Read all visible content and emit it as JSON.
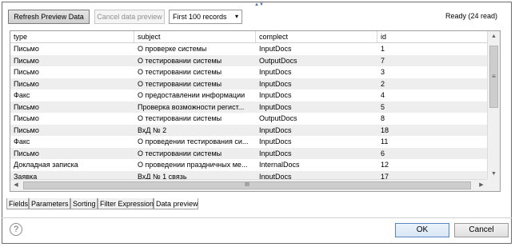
{
  "toolbar": {
    "refresh_label": "Refresh Preview Data",
    "cancel_label": "Cancel data preview",
    "records_selected": "First 100 records",
    "status": "Ready (24 read)"
  },
  "table": {
    "columns": [
      "type",
      "subject",
      "complect",
      "id"
    ],
    "rows": [
      [
        "Письмо",
        "О проверке системы",
        "InputDocs",
        "1"
      ],
      [
        "Письмо",
        "О тестировании системы",
        "OutputDocs",
        "7"
      ],
      [
        "Письмо",
        "О тестировании системы",
        "InputDocs",
        "3"
      ],
      [
        "Письмо",
        "О тестировании системы",
        "InputDocs",
        "2"
      ],
      [
        "Факс",
        "О предоставлении информации",
        "InputDocs",
        "4"
      ],
      [
        "Письмо",
        "Проверка возможности регист...",
        "InputDocs",
        "5"
      ],
      [
        "Письмо",
        "О тестировании системы",
        "OutputDocs",
        "8"
      ],
      [
        "Письмо",
        "ВхД № 2",
        "InputDocs",
        "18"
      ],
      [
        "Факс",
        "О проведении тестирования си...",
        "InputDocs",
        "11"
      ],
      [
        "Письмо",
        "О тестировании системы",
        "InputDocs",
        "6"
      ],
      [
        "Докладная записка",
        "О проведении праздничных ме...",
        "InternalDocs",
        "12"
      ],
      [
        "Заявка",
        "ВхД № 1 связь",
        "InputDocs",
        "17"
      ]
    ]
  },
  "tabs": [
    {
      "label": "Fields"
    },
    {
      "label": "Parameters"
    },
    {
      "label": "Sorting"
    },
    {
      "label": "Filter Expression"
    },
    {
      "label": "Data preview",
      "active": true
    }
  ],
  "footer": {
    "help_glyph": "?",
    "ok_label": "OK",
    "cancel_label": "Cancel"
  },
  "icons": {
    "scroll_grip": "≡",
    "hscroll_grip": "III"
  }
}
